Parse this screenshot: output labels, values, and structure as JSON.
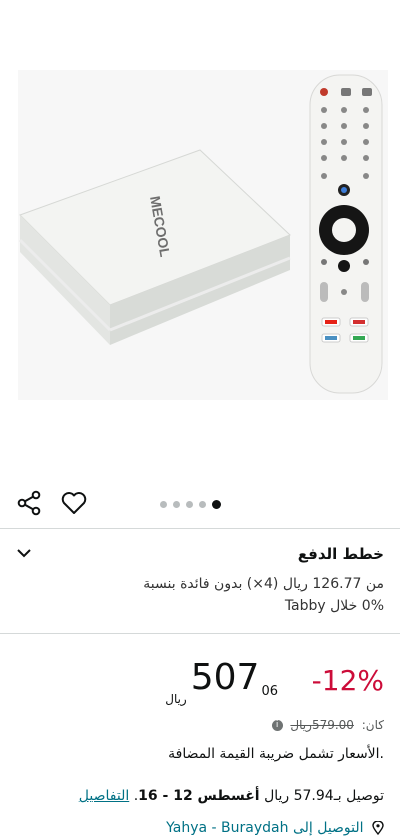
{
  "gallery": {
    "brand_on_box": "MECOOL",
    "remote_buttons": [
      "YouTube",
      "NETFLIX",
      "prime video",
      "Google Play"
    ],
    "dots_total": 5,
    "dot_active_index": 5
  },
  "actions": {
    "share_icon": "share-icon",
    "wishlist_icon": "heart-icon"
  },
  "payment_plans": {
    "title": "خطط الدفع",
    "line1": "من 126.77 ريال (4×) بدون فائدة بنسبة",
    "line2": "0% خلال Tabby"
  },
  "pricing": {
    "discount": "-12%",
    "currency": "ريال",
    "whole": "507",
    "fraction": "06",
    "was_label": "كان:",
    "was_price": "579.00ريال",
    "vat_note": ".الأسعار تشمل ضريبة القيمة المضافة",
    "accent_color": "#CC0C39"
  },
  "delivery": {
    "prefix": "توصيل بـ57.94 ريال",
    "dates": "أغسطس 12 - 16",
    "details_link": "التفاصيل",
    "location": "Yahya - Buraydah التوصيل إلى"
  }
}
